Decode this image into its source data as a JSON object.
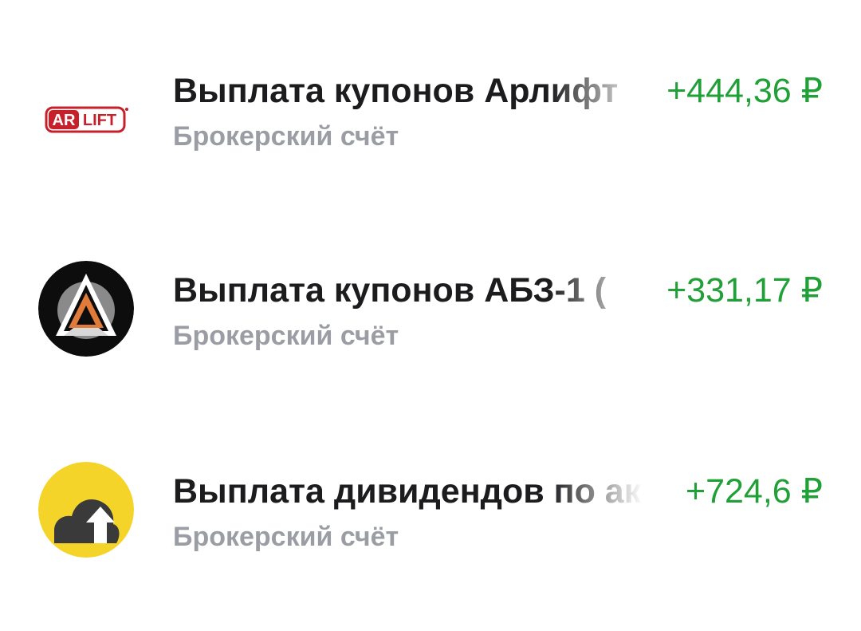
{
  "operations": [
    {
      "logo": "arlift-logo",
      "logo_text": [
        "AR",
        "LIFT"
      ],
      "title": "Выплата купонов Арлифт",
      "subtitle": "Брокерский счёт",
      "amount": "+444,36 ₽"
    },
    {
      "logo": "abz-1-logo",
      "title": "Выплата купонов АБЗ-1 (",
      "subtitle": "Брокерский счёт",
      "amount": "+331,17 ₽"
    },
    {
      "logo": "cloud-upload-logo",
      "title": "Выплата дивидендов по ак",
      "subtitle": "Брокерский счёт",
      "amount": "+724,6 ₽"
    }
  ],
  "colors": {
    "amount_positive": "#21a038",
    "title": "#1c1c1e",
    "subtitle": "#9a9da3",
    "arlift_red": "#c8202a",
    "abz_orange": "#e07b39",
    "yellow_logo": "#f5d42a"
  }
}
